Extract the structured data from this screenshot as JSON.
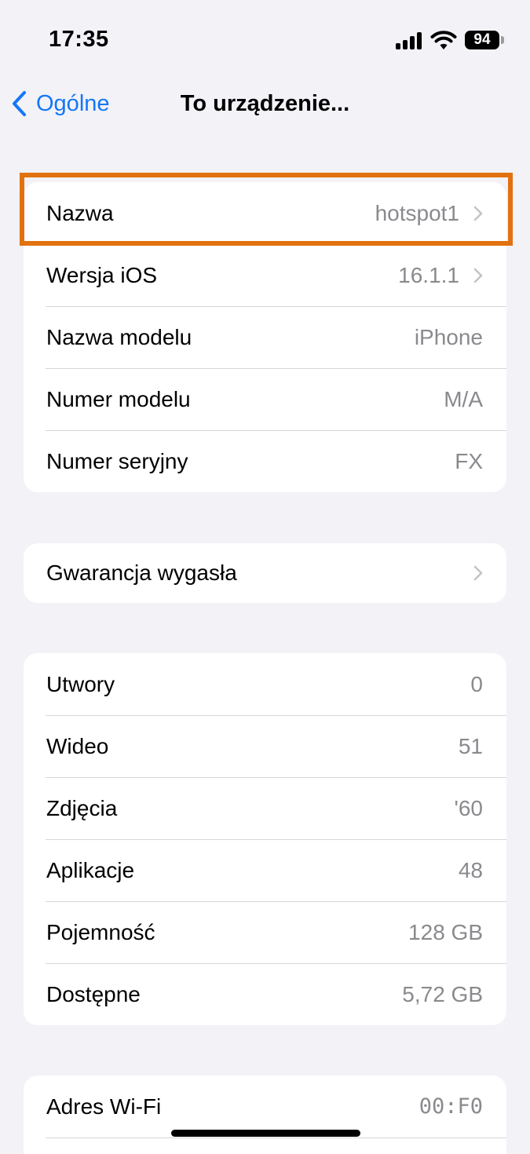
{
  "status_bar": {
    "time": "17:35",
    "battery": "94",
    "icons": [
      "signal-icon",
      "wifi-icon",
      "battery-icon"
    ]
  },
  "nav": {
    "back_label": "Ogólne",
    "title": "To urządzenie..."
  },
  "colors": {
    "accent": "#1477f8",
    "highlight": "#e1720f",
    "background": "#f2f2f7"
  },
  "device_info": [
    {
      "label": "Nazwa",
      "value": "hotspot1",
      "chevron": true
    },
    {
      "label": "Wersja iOS",
      "value": "16.1.1",
      "chevron": true
    },
    {
      "label": "Nazwa modelu",
      "value": "iPhone",
      "chevron": false
    },
    {
      "label": "Numer modelu",
      "value": "M/A",
      "chevron": false
    },
    {
      "label": "Numer seryjny",
      "value": "FX",
      "chevron": false
    }
  ],
  "warranty": {
    "label": "Gwarancja wygasła"
  },
  "stats": [
    {
      "label": "Utwory",
      "value": "0"
    },
    {
      "label": "Wideo",
      "value": "51"
    },
    {
      "label": "Zdjęcia",
      "value": "'60"
    },
    {
      "label": "Aplikacje",
      "value": "48"
    },
    {
      "label": "Pojemność",
      "value": "128 GB"
    },
    {
      "label": "Dostępne",
      "value": "5,72 GB"
    }
  ],
  "network": [
    {
      "label": "Adres Wi-Fi",
      "value": "00:F0"
    }
  ]
}
